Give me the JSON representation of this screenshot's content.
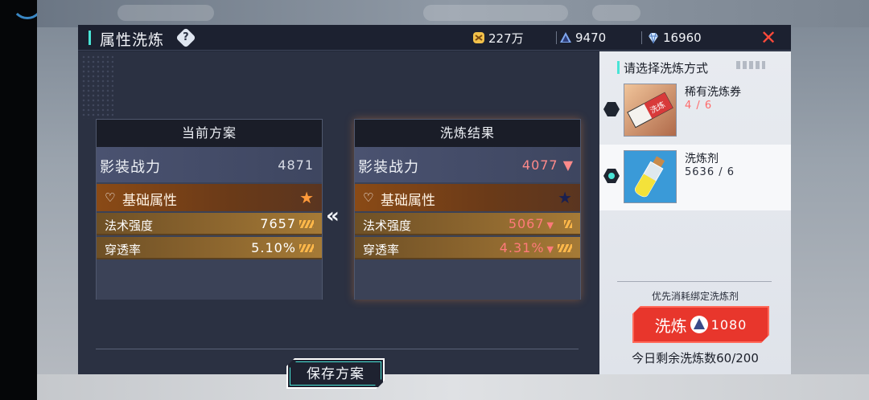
{
  "colors": {
    "accent_cyan": "#49e4d6",
    "decrease_red": "#ff6a6a",
    "close_red": "#ff4a3a",
    "button_red": "#e8362c"
  },
  "header": {
    "title": "属性洗炼",
    "help_icon": "question-icon",
    "close_icon": "close-icon"
  },
  "resources": [
    {
      "icon": "gold-coin-icon",
      "value": "227万"
    },
    {
      "icon": "wash-crystal-icon",
      "value": "9470"
    },
    {
      "icon": "diamond-icon",
      "value": "16960"
    }
  ],
  "current": {
    "title": "当前方案",
    "power_label": "影装战力",
    "power_value": "4871",
    "section_label": "基础属性",
    "attrs": [
      {
        "label": "法术强度",
        "value": "7657"
      },
      {
        "label": "穿透率",
        "value": "5.10%"
      }
    ]
  },
  "result": {
    "title": "洗炼结果",
    "power_label": "影装战力",
    "power_value": "4077",
    "section_label": "基础属性",
    "attrs": [
      {
        "label": "法术强度",
        "value": "5067"
      },
      {
        "label": "穿透率",
        "value": "4.31%"
      }
    ]
  },
  "swap_icon": "double-chevron-left-icon",
  "save_label": "保存方案",
  "side": {
    "title": "请选择洗炼方式",
    "options": [
      {
        "name": "稀有洗炼券",
        "count": "4 / 6",
        "icon": "rare-ticket-icon",
        "selected": false
      },
      {
        "name": "洗炼剂",
        "count": "5636 / 6",
        "icon": "wash-potion-icon",
        "selected": true
      }
    ],
    "priority": "优先消耗绑定洗炼剂",
    "wash_label": "洗炼",
    "wash_cost": "1080",
    "remain": "今日剩余洗炼数60/200"
  }
}
